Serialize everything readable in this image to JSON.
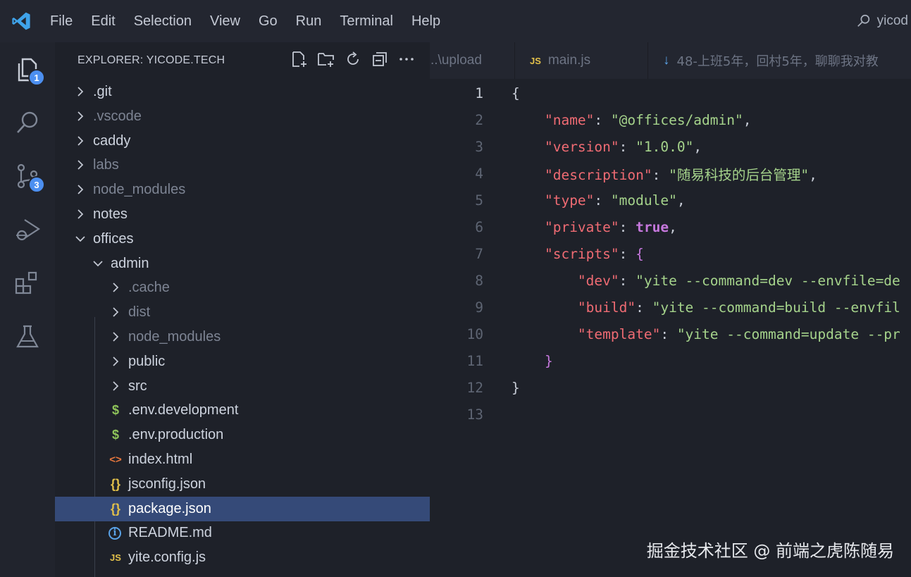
{
  "menu": [
    "File",
    "Edit",
    "Selection",
    "View",
    "Go",
    "Run",
    "Terminal",
    "Help"
  ],
  "search": {
    "text": "yicod"
  },
  "activity": {
    "items": [
      "explorer-icon",
      "search-icon",
      "source-control-icon",
      "run-debug-icon",
      "extensions-icon",
      "testing-icon"
    ],
    "explorer_badge": "1",
    "scm_badge": "3"
  },
  "sidebar": {
    "title": "EXPLORER: YICODE.TECH",
    "actions": [
      "new-file-icon",
      "new-folder-icon",
      "refresh-icon",
      "collapse-all-icon",
      "more-icon"
    ],
    "tree": [
      {
        "label": ".git",
        "type": "folder",
        "expanded": false,
        "level": 0,
        "dim": false
      },
      {
        "label": ".vscode",
        "type": "folder",
        "expanded": false,
        "level": 0,
        "dim": true
      },
      {
        "label": "caddy",
        "type": "folder",
        "expanded": false,
        "level": 0,
        "dim": false
      },
      {
        "label": "labs",
        "type": "folder",
        "expanded": false,
        "level": 0,
        "dim": true
      },
      {
        "label": "node_modules",
        "type": "folder",
        "expanded": false,
        "level": 0,
        "dim": true
      },
      {
        "label": "notes",
        "type": "folder",
        "expanded": false,
        "level": 0,
        "dim": false
      },
      {
        "label": "offices",
        "type": "folder",
        "expanded": true,
        "level": 0,
        "dim": false
      },
      {
        "label": "admin",
        "type": "folder",
        "expanded": true,
        "level": 1,
        "dim": false
      },
      {
        "label": ".cache",
        "type": "folder",
        "expanded": false,
        "level": 2,
        "dim": true
      },
      {
        "label": "dist",
        "type": "folder",
        "expanded": false,
        "level": 2,
        "dim": true
      },
      {
        "label": "node_modules",
        "type": "folder",
        "expanded": false,
        "level": 2,
        "dim": true
      },
      {
        "label": "public",
        "type": "folder",
        "expanded": false,
        "level": 2,
        "dim": false
      },
      {
        "label": "src",
        "type": "folder",
        "expanded": false,
        "level": 2,
        "dim": false
      },
      {
        "label": ".env.development",
        "type": "env",
        "icon": "$",
        "level": 2,
        "dim": false
      },
      {
        "label": ".env.production",
        "type": "env",
        "icon": "$",
        "level": 2,
        "dim": false
      },
      {
        "label": "index.html",
        "type": "html",
        "icon": "<>",
        "level": 2,
        "dim": false
      },
      {
        "label": "jsconfig.json",
        "type": "json",
        "icon": "{}",
        "level": 2,
        "dim": false
      },
      {
        "label": "package.json",
        "type": "json",
        "icon": "{}",
        "level": 2,
        "dim": false,
        "selected": true
      },
      {
        "label": "README.md",
        "type": "info",
        "icon": "i",
        "level": 2,
        "dim": false
      },
      {
        "label": "yite.config.js",
        "type": "js",
        "icon": "JS",
        "level": 2,
        "dim": false
      }
    ]
  },
  "tabs": [
    {
      "label": "..\\upload",
      "icon": "",
      "active": false
    },
    {
      "label": "main.js",
      "icon": "JS",
      "active": false
    },
    {
      "label": "48-上班5年，回村5年，聊聊我对教",
      "icon": "↓",
      "active": false
    }
  ],
  "editor": {
    "active_line": 1,
    "lines": [
      {
        "n": "1",
        "tokens": [
          {
            "t": "{",
            "c": "p"
          }
        ]
      },
      {
        "n": "2",
        "tokens": [
          {
            "t": "    ",
            "c": "p"
          },
          {
            "t": "\"name\"",
            "c": "k"
          },
          {
            "t": ": ",
            "c": "p"
          },
          {
            "t": "\"@offices/admin\"",
            "c": "s"
          },
          {
            "t": ",",
            "c": "p"
          }
        ]
      },
      {
        "n": "3",
        "tokens": [
          {
            "t": "    ",
            "c": "p"
          },
          {
            "t": "\"version\"",
            "c": "k"
          },
          {
            "t": ": ",
            "c": "p"
          },
          {
            "t": "\"1.0.0\"",
            "c": "s"
          },
          {
            "t": ",",
            "c": "p"
          }
        ]
      },
      {
        "n": "4",
        "tokens": [
          {
            "t": "    ",
            "c": "p"
          },
          {
            "t": "\"description\"",
            "c": "k"
          },
          {
            "t": ": ",
            "c": "p"
          },
          {
            "t": "\"随易科技的后台管理\"",
            "c": "s"
          },
          {
            "t": ",",
            "c": "p"
          }
        ]
      },
      {
        "n": "5",
        "tokens": [
          {
            "t": "    ",
            "c": "p"
          },
          {
            "t": "\"type\"",
            "c": "k"
          },
          {
            "t": ": ",
            "c": "p"
          },
          {
            "t": "\"module\"",
            "c": "s"
          },
          {
            "t": ",",
            "c": "p"
          }
        ]
      },
      {
        "n": "6",
        "tokens": [
          {
            "t": "    ",
            "c": "p"
          },
          {
            "t": "\"private\"",
            "c": "k"
          },
          {
            "t": ": ",
            "c": "p"
          },
          {
            "t": "true",
            "c": "kw"
          },
          {
            "t": ",",
            "c": "p"
          }
        ]
      },
      {
        "n": "7",
        "tokens": [
          {
            "t": "    ",
            "c": "p"
          },
          {
            "t": "\"scripts\"",
            "c": "k"
          },
          {
            "t": ": ",
            "c": "p"
          },
          {
            "t": "{",
            "c": "br"
          }
        ]
      },
      {
        "n": "8",
        "tokens": [
          {
            "t": "        ",
            "c": "p"
          },
          {
            "t": "\"dev\"",
            "c": "k"
          },
          {
            "t": ": ",
            "c": "p"
          },
          {
            "t": "\"yite --command=dev --envfile=de",
            "c": "s"
          }
        ]
      },
      {
        "n": "9",
        "tokens": [
          {
            "t": "        ",
            "c": "p"
          },
          {
            "t": "\"build\"",
            "c": "k"
          },
          {
            "t": ": ",
            "c": "p"
          },
          {
            "t": "\"yite --command=build --envfil",
            "c": "s"
          }
        ]
      },
      {
        "n": "10",
        "tokens": [
          {
            "t": "        ",
            "c": "p"
          },
          {
            "t": "\"template\"",
            "c": "k"
          },
          {
            "t": ": ",
            "c": "p"
          },
          {
            "t": "\"yite --command=update --pr",
            "c": "s"
          }
        ]
      },
      {
        "n": "11",
        "tokens": [
          {
            "t": "    ",
            "c": "p"
          },
          {
            "t": "}",
            "c": "br"
          }
        ]
      },
      {
        "n": "12",
        "tokens": [
          {
            "t": "}",
            "c": "p"
          }
        ]
      },
      {
        "n": "13",
        "tokens": []
      }
    ]
  },
  "watermark": "掘金技术社区 @ 前端之虎陈随易",
  "colors": {
    "accent": "#4c8ff0",
    "selection": "#354a78",
    "json_key": "#ef6b73",
    "json_string": "#a5d38b",
    "keyword": "#c678dd",
    "env_icon": "#8fc45a",
    "html_icon": "#e8773d",
    "json_icon": "#e2c04a",
    "js_icon": "#e2c04a",
    "info_icon": "#5aa3e8"
  }
}
